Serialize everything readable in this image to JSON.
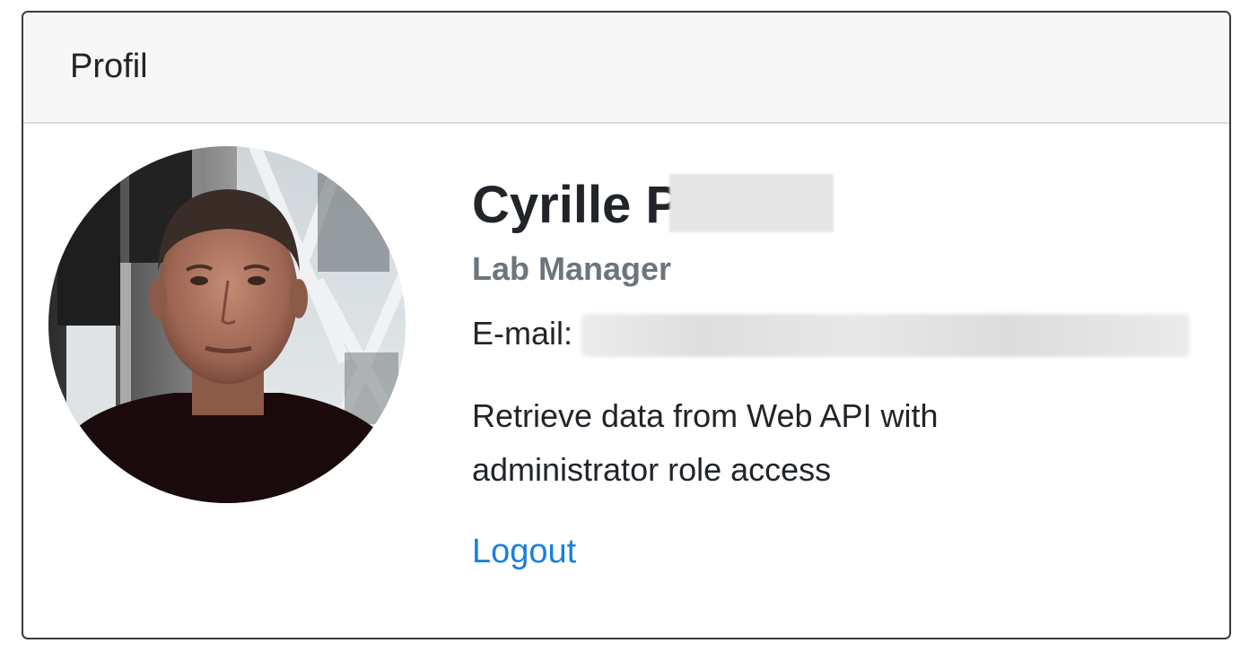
{
  "card": {
    "header_title": "Profil"
  },
  "profile": {
    "avatar_alt": "profile photo",
    "name_visible": "Cyrille P",
    "job_title": "Lab Manager",
    "email_label": "E-mail:",
    "description": "Retrieve data from Web API with administrator role access",
    "logout_label": "Logout"
  },
  "colors": {
    "link": "#1a7fe0",
    "muted": "#6c757d",
    "text": "#212529",
    "header_bg": "#f7f7f7"
  }
}
